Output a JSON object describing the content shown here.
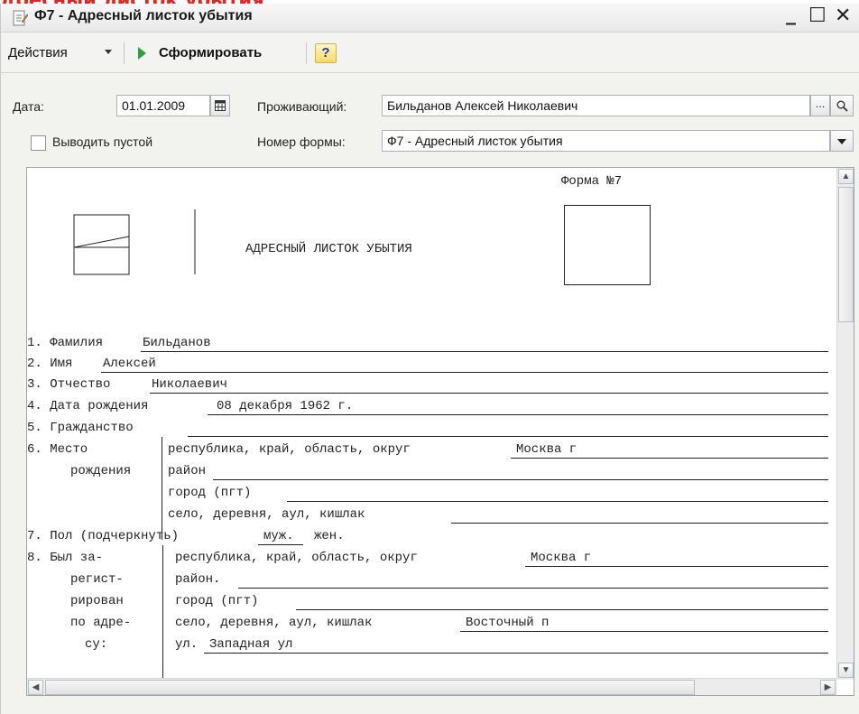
{
  "banner": {
    "text": "дресный листок убытия"
  },
  "window": {
    "title": "Ф7 - Адресный листок убытия",
    "min_glyph": "_",
    "max_glyph": "☐",
    "close_glyph": "✕"
  },
  "toolbar": {
    "actions_label": "Действия",
    "generate_label": "Сформировать",
    "help_label": "?"
  },
  "params": {
    "date_label": "Дата:",
    "date_value": "01.01.2009",
    "resident_label": "Проживающий:",
    "resident_value": "Бильданов Алексей Николаевич",
    "ellipsis_label": "...",
    "show_empty_label": "Выводить пустой",
    "show_empty_checked": false,
    "form_number_label": "Номер формы:",
    "form_number_value": "Ф7 - Адресный листок убытия"
  },
  "form": {
    "form_no": "Форма №7",
    "heading": "АДРЕСНЫЙ ЛИСТОК УБЫТИЯ",
    "rows": {
      "r1_label": "1. Фамилия",
      "r1_value": "Бильданов",
      "r2_label": "2. Имя",
      "r2_value": "Алексей",
      "r3_label": "3. Отчество",
      "r3_value": "Николаевич",
      "r4_label": "4. Дата рождения",
      "r4_value": "08 декабря 1962 г.",
      "r5_label": "5. Гражданство",
      "r6_label_line1": "6. Место",
      "r6_label_line2": "рождения",
      "r6_region_label": "республика, край, область, округ",
      "r6_region_value": "Москва г",
      "r6_district_label": "район",
      "r6_city_label": "город (пгт)",
      "r6_village_label": "село, деревня, аул, кишлак",
      "r7_label": "7. Пол (подчеркнуть)",
      "r7_male": "муж.",
      "r7_female": "жен.",
      "r8_label_line1": "8. Был за-",
      "r8_label_line2": "регист-",
      "r8_label_line3": "рирован",
      "r8_label_line4": "по адре-",
      "r8_label_line5": "су:",
      "r8_region_label": "республика, край, область, округ",
      "r8_region_value": "Москва г",
      "r8_district_label": "район.",
      "r8_city_label": "город (пгт)",
      "r8_village_label": "село, деревня, аул, кишлак",
      "r8_village_value": "Восточный п",
      "r8_street_label": "ул.",
      "r8_street_value": "Западная ул"
    }
  },
  "icons": {
    "title": "form-document-icon",
    "calendar": "calendar-icon",
    "search": "magnifier-icon",
    "dropdown": "triangle-down-icon",
    "run": "play-triangle-icon"
  },
  "colors": {
    "banner_red": "#e8231e",
    "run_green": "#22a83a"
  }
}
